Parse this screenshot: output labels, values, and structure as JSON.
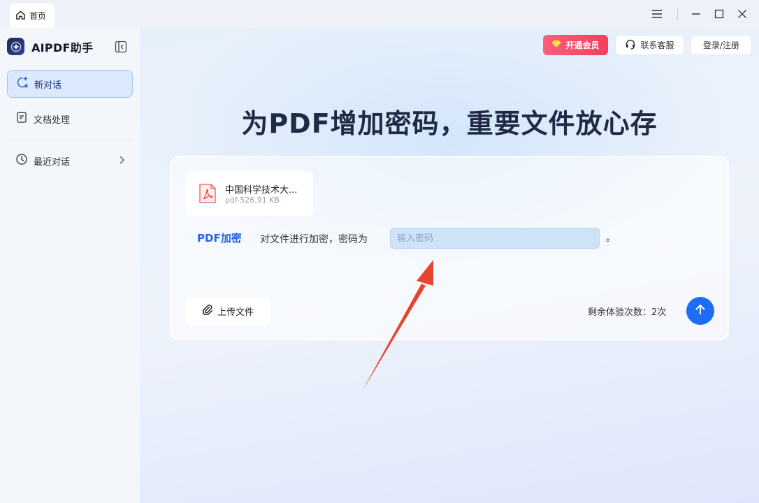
{
  "window": {
    "tab_home": "首页"
  },
  "sidebar": {
    "brand": "AIPDF助手",
    "items": [
      {
        "label": "新对话",
        "icon": "chat-plus-icon"
      },
      {
        "label": "文档处理",
        "icon": "document-icon"
      },
      {
        "label": "最近对话",
        "icon": "clock-icon"
      }
    ]
  },
  "header": {
    "vip_label": "开通会员",
    "service_label": "联系客服",
    "login_label": "登录/注册"
  },
  "main": {
    "headline": "为PDF增加密码，重要文件放心存",
    "file": {
      "name": "中国科学技术大...",
      "meta": "pdf-526.91 KB"
    },
    "tool_label": "PDF加密",
    "prompt": "对文件进行加密，密码为",
    "password_placeholder": "输入密码",
    "period": "。",
    "upload_label": "上传文件",
    "trials_text": "剩余体验次数：2次"
  },
  "colors": {
    "accent": "#2563eb",
    "send_button": "#1d6ef5",
    "vip": "#f43f5e",
    "annotation_arrow": "#e8432e"
  }
}
